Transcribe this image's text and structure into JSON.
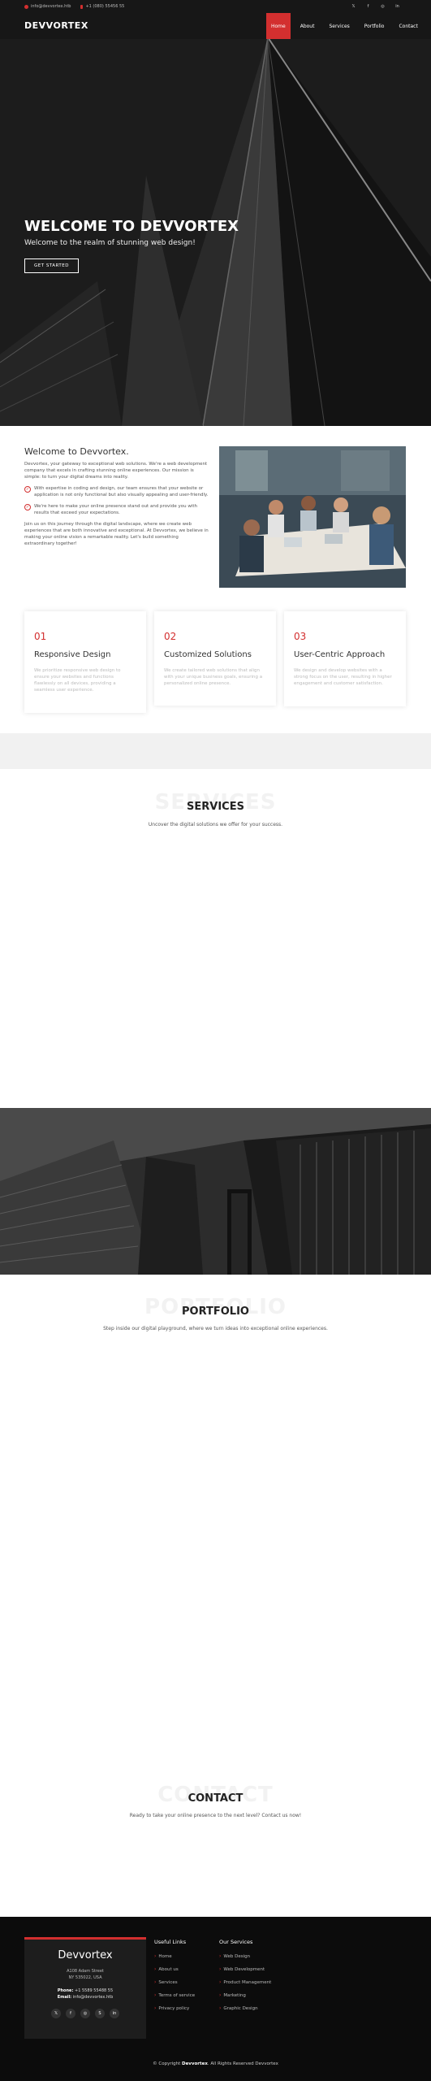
{
  "topbar": {
    "email": "info@devvortex.htb",
    "phone": "+1 (080) 55456 55",
    "socials": [
      "twitter-icon",
      "facebook-icon",
      "instagram-icon",
      "linkedin-icon"
    ]
  },
  "header": {
    "logo": "DEVVORTEX",
    "nav": [
      "Home",
      "About",
      "Services",
      "Portfolio",
      "Contact"
    ],
    "active": "Home"
  },
  "hero": {
    "title": "WELCOME TO DEVVORTEX",
    "subtitle": "Welcome to the realm of stunning web design!",
    "button": "GET STARTED"
  },
  "about": {
    "title": "Welcome to Devvortex.",
    "intro": "Devvortex, your gateway to exceptional web solutions. We're a web development company that excels in crafting stunning online experiences. Our mission is simple: to turn your digital dreams into reality.",
    "point1": "With expertise in coding and design, our team ensures that your website or application is not only functional but also visually appealing and user-friendly.",
    "point2": "We're here to make your online presence stand out and provide you with results that exceed your expectations.",
    "outro": "Join us on this journey through the digital landscape, where we create web experiences that are both innovative and exceptional. At Devvortex, we believe in making your online vision a remarkable reality. Let's build something extraordinary together!"
  },
  "features": [
    {
      "num": "01",
      "title": "Responsive Design",
      "desc": "We prioritize responsive web design to ensure your websites and functions flawlessly on all devices, providing a seamless user experience."
    },
    {
      "num": "02",
      "title": "Customized Solutions",
      "desc": "We create tailored web solutions that align with your unique business goals, ensuring a personalized online presence."
    },
    {
      "num": "03",
      "title": "User-Centric Approach",
      "desc": "We design and develop websites with a strong focus on the user, resulting in higher engagement and customer satisfaction."
    }
  ],
  "services": {
    "bg": "SERVICES",
    "title": "SERVICES",
    "subtitle": "Uncover the digital solutions we offer for your success."
  },
  "portfolio": {
    "bg": "PORTFOLIO",
    "title": "PORTFOLIO",
    "subtitle": "Step inside our digital playground, where we turn ideas into exceptional online experiences."
  },
  "contact": {
    "bg": "CONTACT",
    "title": "CONTACT",
    "subtitle": "Ready to take your online presence to the next level? Contact us now!"
  },
  "footer": {
    "brand": "Devvortex",
    "address1": "A108 Adam Street",
    "address2": "NY 535022, USA",
    "phone_label": "Phone:",
    "phone": "+1 5589 55488 55",
    "email_label": "Email:",
    "email": "info@devvortex.htb",
    "socials": [
      "twitter-icon",
      "facebook-icon",
      "instagram-icon",
      "skype-icon",
      "linkedin-icon"
    ],
    "links_title": "Useful Links",
    "links": [
      "Home",
      "About us",
      "Services",
      "Terms of service",
      "Privacy policy"
    ],
    "services_title": "Our Services",
    "services": [
      "Web Design",
      "Web Development",
      "Product Management",
      "Marketing",
      "Graphic Design"
    ],
    "copyright_pre": "© Copyright",
    "copyright_brand": "Devvortex",
    "copyright_post": ". All Rights Reserved Devvortex"
  },
  "colors": {
    "accent": "#d32f2f",
    "dark": "#0c0c0c"
  }
}
